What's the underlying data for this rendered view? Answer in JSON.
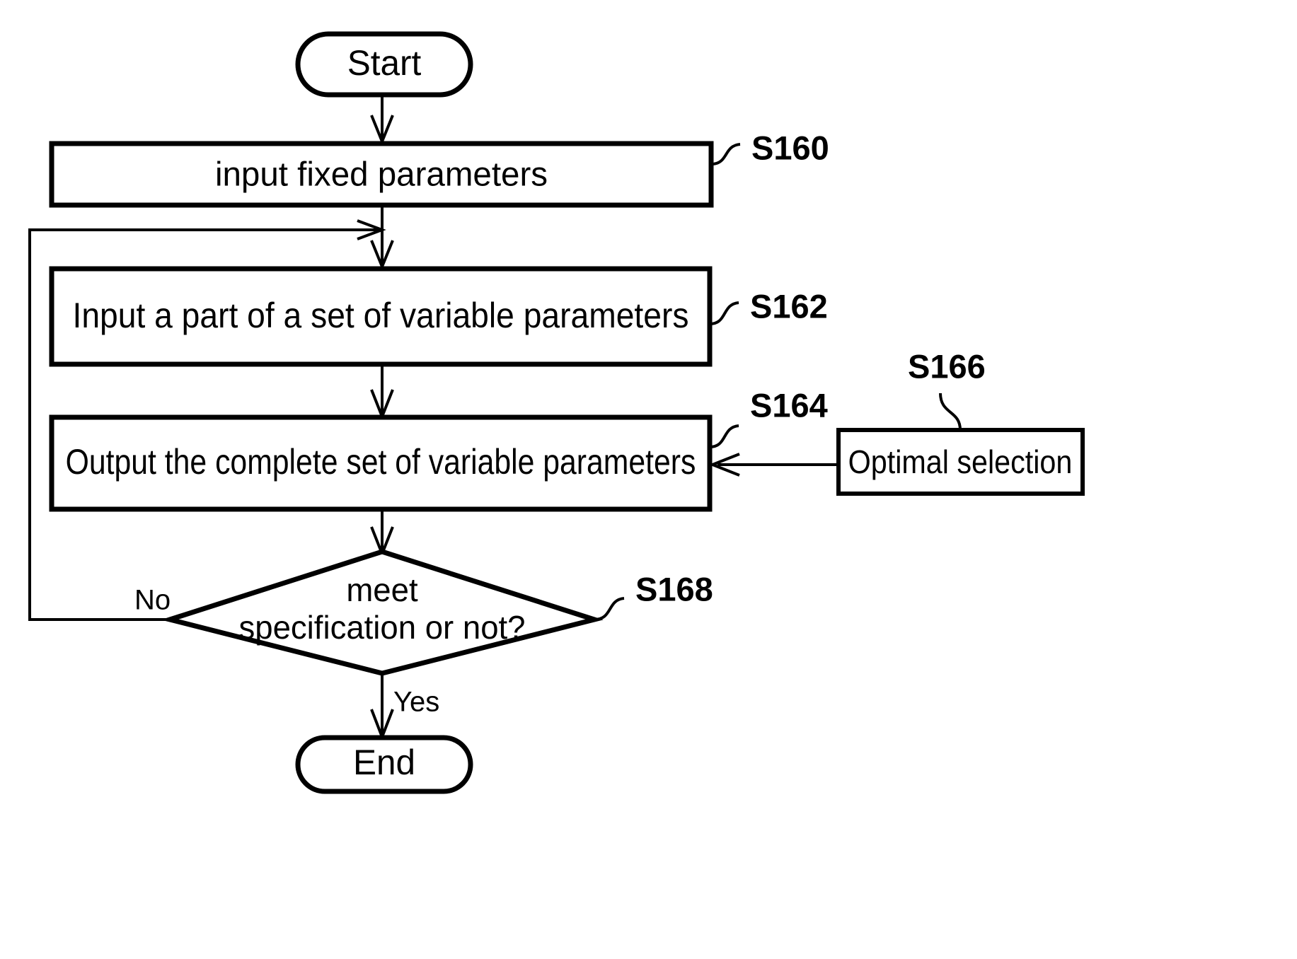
{
  "figure": {
    "type": "flowchart",
    "title": "",
    "background_color": "#ffffff",
    "line_color": "#000000"
  },
  "nodes": {
    "start": {
      "label": "Start",
      "shape": "terminator"
    },
    "s160": {
      "label": "input fixed parameters",
      "shape": "process",
      "step_id": "S160"
    },
    "s162": {
      "label": "Input a part of a set of variable parameters",
      "shape": "process",
      "step_id": "S162"
    },
    "s164": {
      "label": "Output the complete set of variable parameters",
      "shape": "process",
      "step_id": "S164"
    },
    "s166": {
      "label": "Optimal selection",
      "shape": "process",
      "step_id": "S166"
    },
    "s168": {
      "label_line1": "meet",
      "label_line2": "specification or not?",
      "shape": "decision",
      "step_id": "S168"
    },
    "end": {
      "label": "End",
      "shape": "terminator"
    }
  },
  "edge_labels": {
    "no": "No",
    "yes": "Yes"
  },
  "step_ids": {
    "s160": "S160",
    "s162": "S162",
    "s164": "S164",
    "s166": "S166",
    "s168": "S168"
  }
}
